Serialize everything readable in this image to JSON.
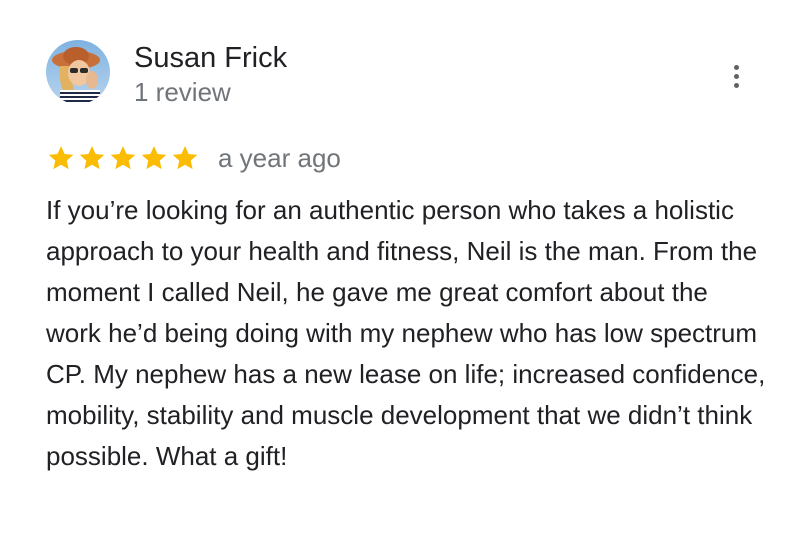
{
  "review": {
    "author_name": "Susan Frick",
    "review_count": "1 review",
    "rating": 5,
    "rating_max": 5,
    "date": "a year ago",
    "text": "If you’re looking for an authentic person who takes a holistic approach to your health and fitness, Neil is the man. From the moment I called Neil, he gave me great comfort about the work he’d being doing with my nephew who has low spectrum CP. My nephew has a new lease on life; increased confidence, mobility, stability and muscle development that we didn’t think possible. What a gift!"
  },
  "colors": {
    "star": "#fbbc04",
    "text_primary": "#202124",
    "text_secondary": "#70757a",
    "icon": "#5f6368"
  },
  "icons": {
    "menu": "more-vert-icon",
    "star": "star-icon"
  }
}
